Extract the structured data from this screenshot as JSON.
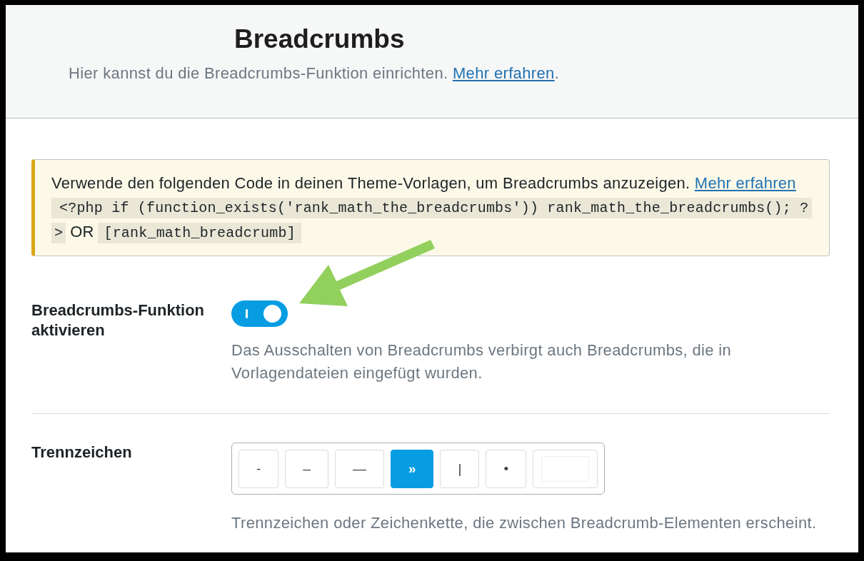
{
  "header": {
    "title": "Breadcrumbs",
    "description": "Hier kannst du die Breadcrumbs-Funktion einrichten.",
    "link": "Mehr erfahren",
    "suffix": "."
  },
  "notice": {
    "text": "Verwende den folgenden Code in deinen Theme-Vorlagen, um Breadcrumbs anzuzeigen.",
    "link": "Mehr erfahren",
    "code_lines": [
      "<?php if (function_exists('rank_math_the_breadcrumbs')) rank_math_the_breadcrumbs(); ?",
      ">"
    ],
    "conjunction": "OR",
    "shortcode": "[rank_math_breadcrumb]"
  },
  "settings": [
    {
      "kind": "toggle",
      "label": "Breadcrumbs-Funktion aktivieren",
      "on": true,
      "description": "Das Ausschalten von Breadcrumbs verbirgt auch Breadcrumbs, die in Vorlagendateien eingefügt wurden."
    },
    {
      "kind": "separator",
      "label": "Trennzeichen",
      "options": [
        {
          "kind": "symbol",
          "symbol": "-",
          "selected": false
        },
        {
          "kind": "symbol",
          "symbol": "–",
          "selected": false
        },
        {
          "kind": "symbol",
          "symbol": "—",
          "selected": false
        },
        {
          "kind": "symbol",
          "symbol": "»",
          "selected": true
        },
        {
          "kind": "symbol",
          "symbol": "|",
          "selected": false
        },
        {
          "kind": "symbol",
          "symbol": "•",
          "selected": false
        },
        {
          "kind": "custom",
          "selected": false
        }
      ],
      "description": "Trennzeichen oder Zeichenkette, die zwischen Breadcrumb-Elementen erscheint."
    }
  ]
}
